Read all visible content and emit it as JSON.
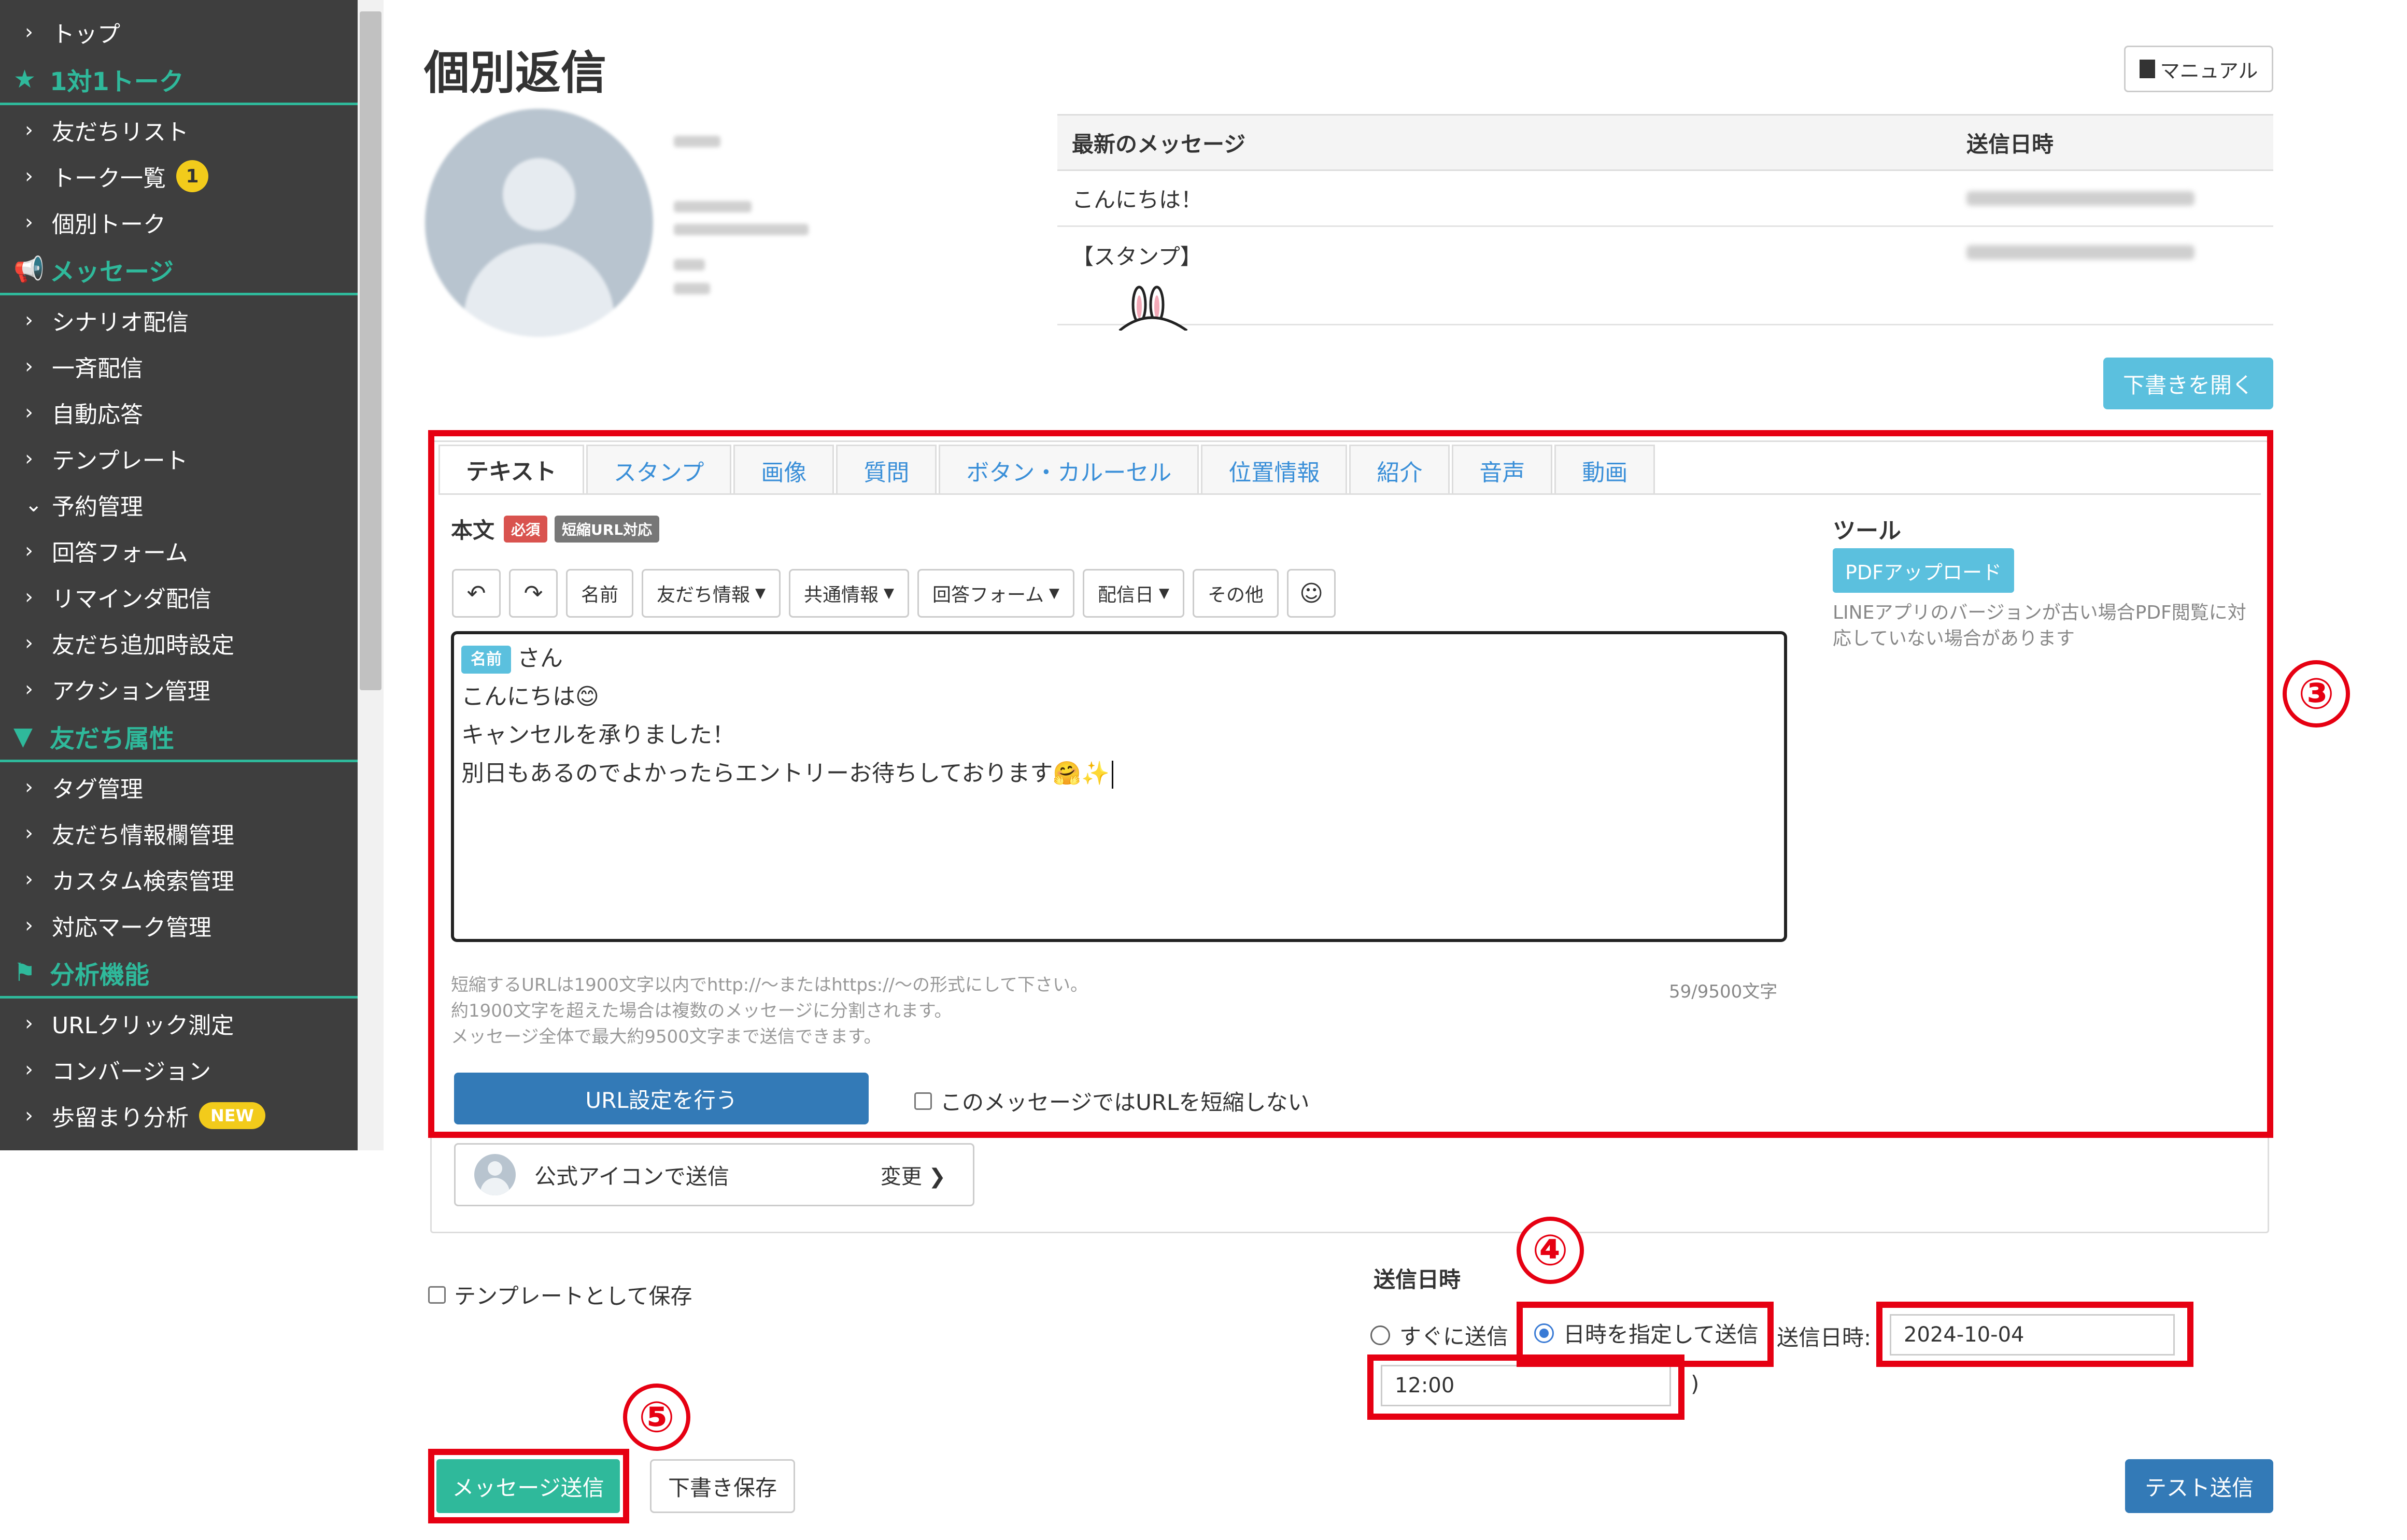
{
  "sidebar": {
    "items": [
      {
        "kind": "item",
        "label": "トップ"
      },
      {
        "kind": "section",
        "label": "1対1トーク",
        "icon": "star-icon"
      },
      {
        "kind": "item",
        "label": "友だちリスト"
      },
      {
        "kind": "item",
        "label": "トーク一覧",
        "badge": "1"
      },
      {
        "kind": "item",
        "label": "個別トーク"
      },
      {
        "kind": "section",
        "label": "メッセージ",
        "icon": "megaphone-icon"
      },
      {
        "kind": "item",
        "label": "シナリオ配信"
      },
      {
        "kind": "item",
        "label": "一斉配信"
      },
      {
        "kind": "item",
        "label": "自動応答"
      },
      {
        "kind": "item",
        "label": "テンプレート"
      },
      {
        "kind": "item",
        "label": "予約管理",
        "expanded": true
      },
      {
        "kind": "item",
        "label": "回答フォーム"
      },
      {
        "kind": "item",
        "label": "リマインダ配信"
      },
      {
        "kind": "item",
        "label": "友だち追加時設定"
      },
      {
        "kind": "item",
        "label": "アクション管理"
      },
      {
        "kind": "section",
        "label": "友だち属性",
        "icon": "filter-icon"
      },
      {
        "kind": "item",
        "label": "タグ管理"
      },
      {
        "kind": "item",
        "label": "友だち情報欄管理"
      },
      {
        "kind": "item",
        "label": "カスタム検索管理"
      },
      {
        "kind": "item",
        "label": "対応マーク管理"
      },
      {
        "kind": "section",
        "label": "分析機能",
        "icon": "flag-icon"
      },
      {
        "kind": "item",
        "label": "URLクリック測定"
      },
      {
        "kind": "item",
        "label": "コンバージョン"
      },
      {
        "kind": "item",
        "label": "歩留まり分析",
        "badge_new": "NEW"
      }
    ]
  },
  "header": {
    "title": "個別返信",
    "manual_label": "マニュアル"
  },
  "messages": {
    "col_message": "最新のメッセージ",
    "col_sent": "送信日時",
    "rows": [
      {
        "text": "こんにちは！"
      },
      {
        "text": "【スタンプ】"
      }
    ]
  },
  "draft_open_label": "下書きを開く",
  "tabs": [
    "テキスト",
    "スタンプ",
    "画像",
    "質問",
    "ボタン・カルーセル",
    "位置情報",
    "紹介",
    "音声",
    "動画"
  ],
  "editor": {
    "body_label": "本文",
    "required_tag": "必須",
    "short_url_tag": "短縮URL対応",
    "toolbar": {
      "undo": "↶",
      "redo": "↷",
      "name": "名前",
      "friend_info": "友だち情報",
      "shared_info": "共通情報",
      "answer_form": "回答フォーム",
      "delivery_date": "配信日",
      "other": "その他",
      "emoji": "☺"
    },
    "name_chip": "名前",
    "line1_suffix": "さん",
    "line2": "こんにちは😊",
    "line3": "キャンセルを承りました！",
    "line4": "別日もあるのでよかったらエントリーお待ちしております🤗✨",
    "note1": "短縮するURLは1900文字以内でhttp://～またはhttps://～の形式にして下さい。",
    "note2": "約1900文字を超えた場合は複数のメッセージに分割されます。",
    "note3": "メッセージ全体で最大約9500文字まで送信できます。",
    "char_count": "59/9500文字",
    "url_button": "URL設定を行う",
    "no_shorten_label": "このメッセージではURLを短縮しない"
  },
  "tool": {
    "label": "ツール",
    "pdf_button": "PDFアップロード",
    "pdf_note": "LINEアプリのバージョンが古い場合PDF閲覧に対応していない場合があります"
  },
  "sender": {
    "label": "公式アイコンで送信",
    "change_label": "変更"
  },
  "template_save_label": "テンプレートとして保存",
  "send_time": {
    "label": "送信日時",
    "now_label": "すぐに送信",
    "scheduled_label": "日時を指定して送信",
    "datetime_label": "送信日時:",
    "date_value": "2024-10-04",
    "time_value": "12:00",
    "close_paren": ")"
  },
  "buttons": {
    "send": "メッセージ送信",
    "draft_save": "下書き保存",
    "test_send": "テスト送信"
  },
  "annotations": {
    "n3": "③",
    "n4": "④",
    "n5": "⑤"
  },
  "colors": {
    "sidebar_bg": "#3e3e3e",
    "accent_green": "#2fb99b",
    "primary_blue": "#337ab7",
    "info_blue": "#5bc0de",
    "highlight_red": "#e60012"
  }
}
